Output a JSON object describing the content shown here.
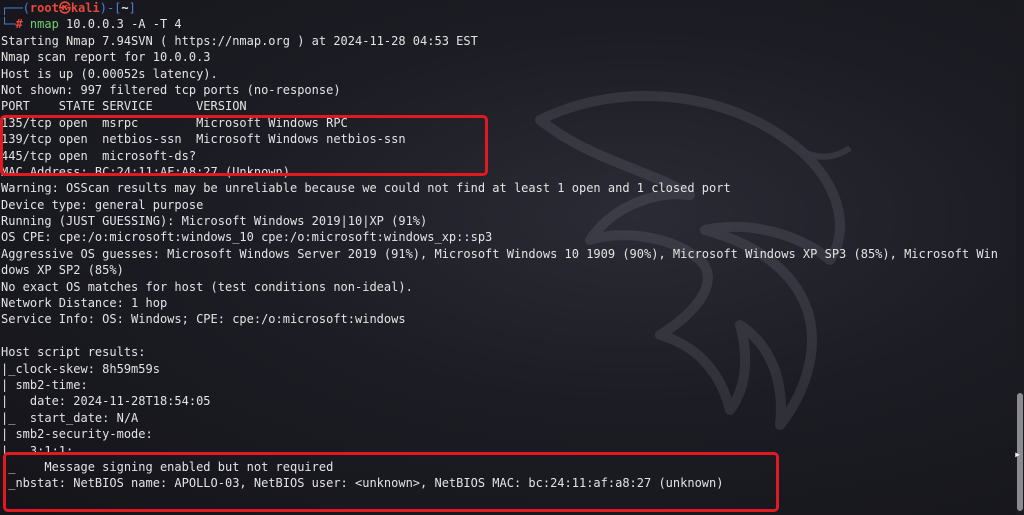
{
  "prompt": {
    "user": "root",
    "at": "㉿",
    "host": "kali",
    "cwd": "~",
    "symbol": "#",
    "command_bin": "nmap",
    "command_args": " 10.0.0.3 -A -T 4"
  },
  "output": [
    "Starting Nmap 7.94SVN ( https://nmap.org ) at 2024-11-28 04:53 EST",
    "Nmap scan report for 10.0.0.3",
    "Host is up (0.00052s latency).",
    "Not shown: 997 filtered tcp ports (no-response)",
    "PORT    STATE SERVICE      VERSION",
    "135/tcp open  msrpc        Microsoft Windows RPC",
    "139/tcp open  netbios-ssn  Microsoft Windows netbios-ssn",
    "445/tcp open  microsoft-ds?",
    "MAC Address: BC:24:11:AF:A8:27 (Unknown)",
    "Warning: OSScan results may be unreliable because we could not find at least 1 open and 1 closed port",
    "Device type: general purpose",
    "Running (JUST GUESSING): Microsoft Windows 2019|10|XP (91%)",
    "OS CPE: cpe:/o:microsoft:windows_10 cpe:/o:microsoft:windows_xp::sp3",
    "Aggressive OS guesses: Microsoft Windows Server 2019 (91%), Microsoft Windows 10 1909 (90%), Microsoft Windows XP SP3 (85%), Microsoft Win",
    "dows XP SP2 (85%)",
    "No exact OS matches for host (test conditions non-ideal).",
    "Network Distance: 1 hop",
    "Service Info: OS: Windows; CPE: cpe:/o:microsoft:windows",
    "",
    "Host script results:",
    "|_clock-skew: 8h59m59s",
    "| smb2-time:",
    "|   date: 2024-11-28T18:54:05",
    "|_  start_date: N/A",
    "| smb2-security-mode:",
    "|   3:1:1:",
    "|_    Message signing enabled but not required",
    "|_nbstat: NetBIOS name: APOLLO-03, NetBIOS user: <unknown>, NetBIOS MAC: bc:24:11:af:a8:27 (unknown)"
  ],
  "colors": {
    "highlight_box": "#e11a22",
    "prompt_red": "#e8473b",
    "prompt_blue": "#4a7fd6",
    "command_green": "#6fd06f"
  }
}
